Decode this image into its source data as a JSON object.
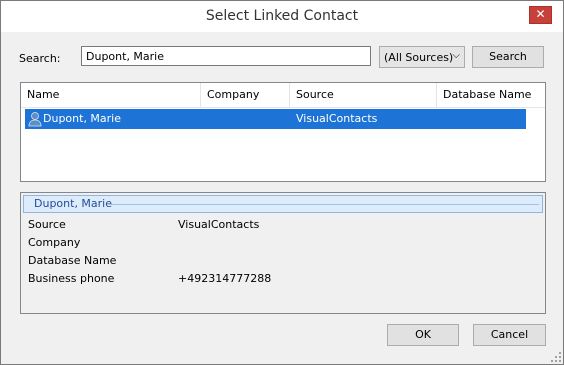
{
  "window": {
    "title": "Select Linked Contact"
  },
  "search": {
    "label": "Search:",
    "value": "Dupont, Marie",
    "source_selected": "(All Sources)",
    "button_label": "Search"
  },
  "results": {
    "columns": [
      "Name",
      "Company",
      "Source",
      "Database Name"
    ],
    "rows": [
      {
        "name": "Dupont, Marie",
        "company": "",
        "source": "VisualContacts",
        "database": "",
        "icon": "person-icon",
        "selected": true
      }
    ]
  },
  "details": {
    "header": "Dupont, Marie",
    "fields": [
      {
        "key": "Source",
        "value": "VisualContacts"
      },
      {
        "key": "Company",
        "value": ""
      },
      {
        "key": "Database Name",
        "value": ""
      },
      {
        "key": "Business phone",
        "value": "+492314777288"
      }
    ]
  },
  "footer": {
    "ok_label": "OK",
    "cancel_label": "Cancel"
  },
  "colors": {
    "selection": "#1e74d6",
    "details_header_bg": "#deebfa",
    "close_button": "#c7413a"
  }
}
